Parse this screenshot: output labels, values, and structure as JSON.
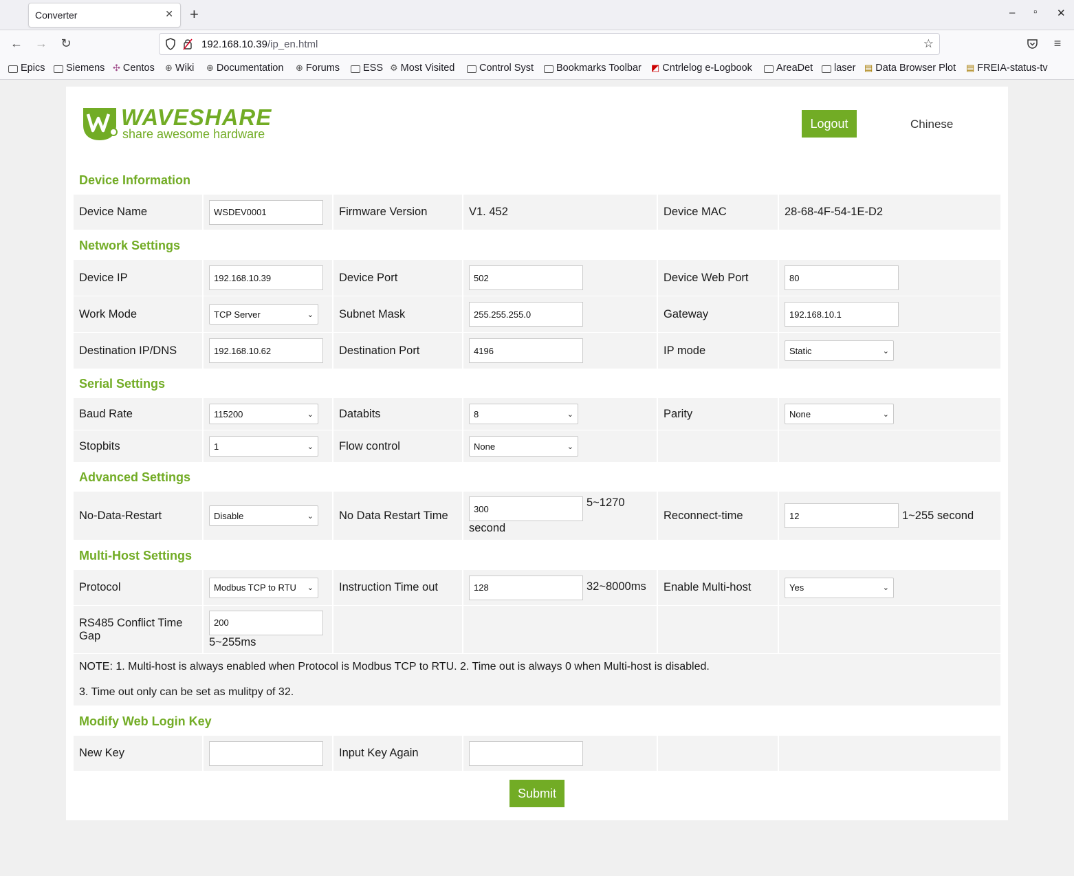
{
  "browser": {
    "tab_title": "Converter",
    "url_host": "192.168.10.39",
    "url_path": "/ip_en.html",
    "bookmarks": [
      "Epics",
      "Siemens",
      "Centos",
      "Wiki",
      "Documentation",
      "Forums",
      "ESS",
      "Most Visited",
      "Control Syst",
      "Bookmarks Toolbar",
      "Cntrlelog e-Logbook",
      "AreaDet",
      "laser",
      "Data Browser Plot",
      "FREIA-status-tv"
    ]
  },
  "header": {
    "logo_name": "WAVESHARE",
    "logo_tagline": "share awesome hardware",
    "logout_label": "Logout",
    "language_label": "Chinese"
  },
  "device_info": {
    "title": "Device Information",
    "device_name_label": "Device Name",
    "device_name_value": "WSDEV0001",
    "firmware_label": "Firmware Version",
    "firmware_value": "V1. 452",
    "mac_label": "Device MAC",
    "mac_value": "28-68-4F-54-1E-D2"
  },
  "network": {
    "title": "Network Settings",
    "device_ip_label": "Device IP",
    "device_ip_value": "192.168.10.39",
    "device_port_label": "Device Port",
    "device_port_value": "502",
    "web_port_label": "Device Web Port",
    "web_port_value": "80",
    "work_mode_label": "Work Mode",
    "work_mode_value": "TCP Server",
    "subnet_label": "Subnet Mask",
    "subnet_value": "255.255.255.0",
    "gateway_label": "Gateway",
    "gateway_value": "192.168.10.1",
    "dest_ip_label": "Destination IP/DNS",
    "dest_ip_value": "192.168.10.62",
    "dest_port_label": "Destination Port",
    "dest_port_value": "4196",
    "ip_mode_label": "IP mode",
    "ip_mode_value": "Static"
  },
  "serial": {
    "title": "Serial Settings",
    "baud_label": "Baud Rate",
    "baud_value": "115200",
    "databits_label": "Databits",
    "databits_value": "8",
    "parity_label": "Parity",
    "parity_value": "None",
    "stopbits_label": "Stopbits",
    "stopbits_value": "1",
    "flow_label": "Flow control",
    "flow_value": "None"
  },
  "advanced": {
    "title": "Advanced Settings",
    "no_data_restart_label": "No-Data-Restart",
    "no_data_restart_value": "Disable",
    "restart_time_label": "No Data Restart Time",
    "restart_time_value": "300",
    "restart_time_unit": "5~1270",
    "restart_time_unit2": "second",
    "reconnect_label": "Reconnect-time",
    "reconnect_value": "12",
    "reconnect_unit": "1~255 second"
  },
  "multihost": {
    "title": "Multi-Host Settings",
    "protocol_label": "Protocol",
    "protocol_value": "Modbus TCP to RTU",
    "timeout_label": "Instruction Time out",
    "timeout_value": "128",
    "timeout_unit": "32~8000ms",
    "enable_label": "Enable Multi-host",
    "enable_value": "Yes",
    "conflict_label": "RS485 Conflict Time Gap",
    "conflict_value": "200",
    "conflict_unit": "5~255ms",
    "note1": "NOTE: 1. Multi-host is always enabled when Protocol is Modbus TCP to RTU. 2. Time out is always 0 when Multi-host is disabled.",
    "note2": "3. Time out only can be set as mulitpy of 32."
  },
  "login_key": {
    "title": "Modify Web Login Key",
    "new_key_label": "New Key",
    "new_key_value": "",
    "again_label": "Input Key Again",
    "again_value": ""
  },
  "submit_label": "Submit",
  "colors": {
    "accent": "#72ac25",
    "cell_bg": "#f3f3f3"
  }
}
